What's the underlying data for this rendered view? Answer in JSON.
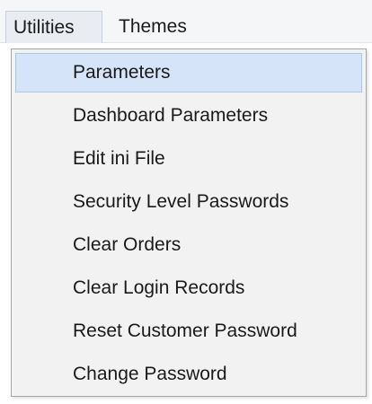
{
  "menubar": {
    "items": [
      {
        "label": "Utilities"
      },
      {
        "label": "Themes"
      }
    ]
  },
  "dropdown": {
    "items": [
      {
        "label": "Parameters",
        "highlighted": true
      },
      {
        "label": "Dashboard Parameters"
      },
      {
        "label": "Edit ini File"
      },
      {
        "label": "Security Level Passwords"
      },
      {
        "label": "Clear Orders"
      },
      {
        "label": "Clear Login Records"
      },
      {
        "label": "Reset Customer Password"
      },
      {
        "label": "Change Password"
      }
    ]
  },
  "colors": {
    "menu_background": "#f2f2f2",
    "highlight_background": "#d5e4f8",
    "highlight_border": "#a9c6ec",
    "menubar_background": "#f5f6f7"
  }
}
